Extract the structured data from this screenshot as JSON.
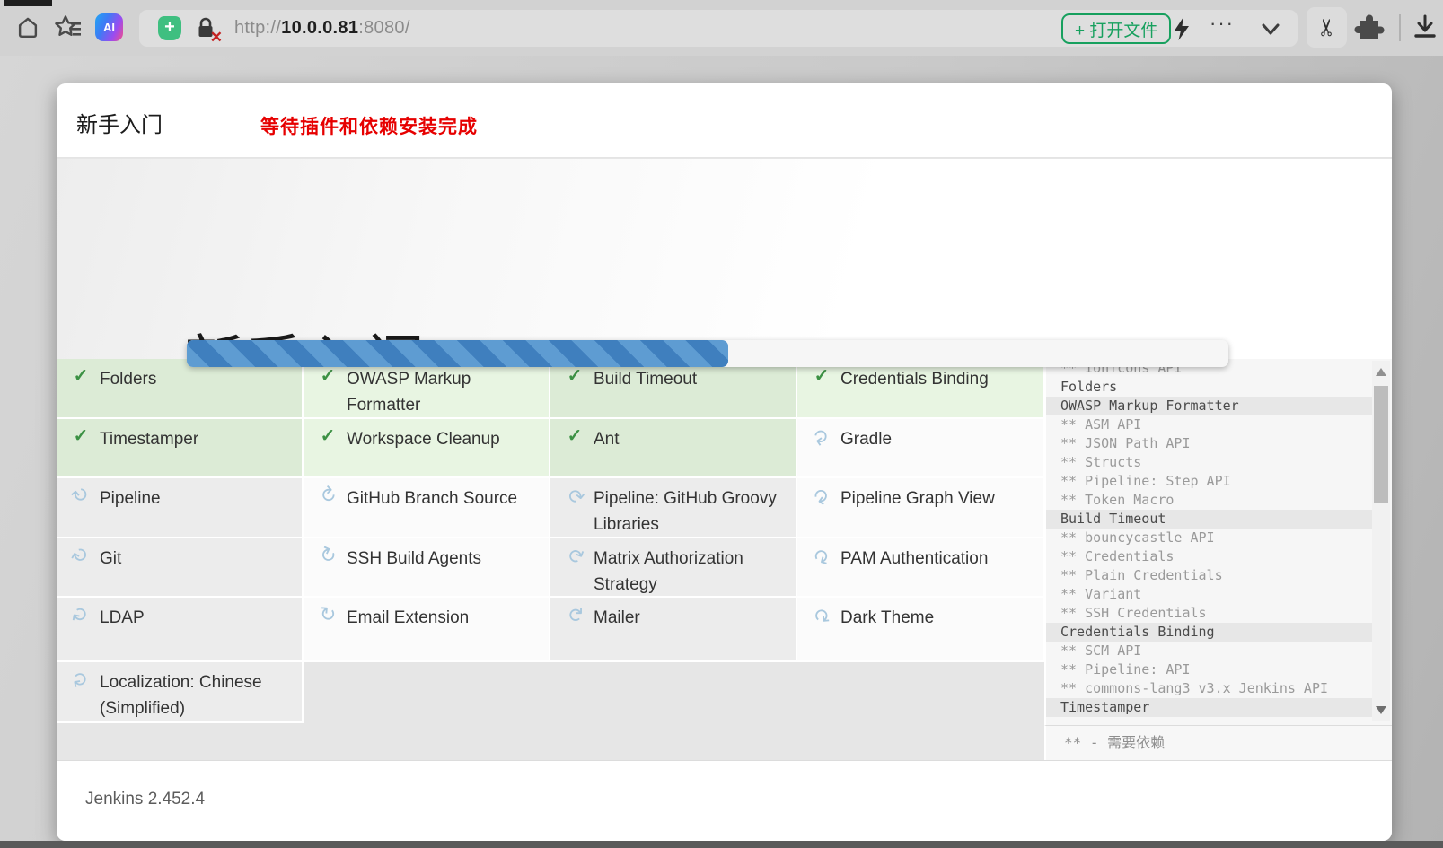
{
  "browser": {
    "url": {
      "scheme": "http://",
      "host": "10.0.0.81",
      "port": ":8080",
      "path": "/"
    },
    "open_file_button": "+ 打开文件",
    "ai_badge": "AI",
    "shield_plus": "+",
    "dots": "···",
    "scissors_glyph": "✂"
  },
  "wizard": {
    "header_title": "新手入门",
    "header_notice": "等待插件和依赖安装完成",
    "hero_title": "新手入门",
    "progress_percent": 52,
    "legend": "** - 需要依赖",
    "footer_version": "Jenkins 2.452.4"
  },
  "colors": {
    "progress_blue_light": "#5e9cd2",
    "progress_blue_dark": "#3f7fbe",
    "success_green": "#3c9144",
    "notice_red": "#e60000",
    "button_green": "#17a05e",
    "done_cell_green": "#e8f5e2",
    "spinner_blue": "#a9c8de"
  },
  "plugins": {
    "cells": [
      {
        "label": "Folders",
        "status": "done"
      },
      {
        "label": "OWASP Markup Formatter",
        "status": "done"
      },
      {
        "label": "Build Timeout",
        "status": "done"
      },
      {
        "label": "Credentials Binding",
        "status": "done"
      },
      {
        "label": "Timestamper",
        "status": "done"
      },
      {
        "label": "Workspace Cleanup",
        "status": "done"
      },
      {
        "label": "Ant",
        "status": "done"
      },
      {
        "label": "Gradle",
        "status": "installing"
      },
      {
        "label": "Pipeline",
        "status": "installing"
      },
      {
        "label": "GitHub Branch Source",
        "status": "installing"
      },
      {
        "label": "Pipeline: GitHub Groovy Libraries",
        "status": "installing"
      },
      {
        "label": "Pipeline Graph View",
        "status": "installing"
      },
      {
        "label": "Git",
        "status": "installing"
      },
      {
        "label": "SSH Build Agents",
        "status": "installing"
      },
      {
        "label": "Matrix Authorization Strategy",
        "status": "installing"
      },
      {
        "label": "PAM Authentication",
        "status": "installing"
      },
      {
        "label": "LDAP",
        "status": "installing"
      },
      {
        "label": "Email Extension",
        "status": "installing"
      },
      {
        "label": "Mailer",
        "status": "installing"
      },
      {
        "label": "Dark Theme",
        "status": "installing"
      },
      {
        "label": "Localization: Chinese (Simplified)",
        "status": "installing"
      },
      {
        "label": "",
        "status": "empty"
      },
      {
        "label": "",
        "status": "empty"
      },
      {
        "label": "",
        "status": "empty"
      }
    ]
  },
  "log": {
    "items": [
      {
        "text": "** Ionicons API",
        "dep": true,
        "highlight": false
      },
      {
        "text": "Folders",
        "dep": false,
        "highlight": false
      },
      {
        "text": "OWASP Markup Formatter",
        "dep": false,
        "highlight": true
      },
      {
        "text": "** ASM API",
        "dep": true,
        "highlight": false
      },
      {
        "text": "** JSON Path API",
        "dep": true,
        "highlight": false
      },
      {
        "text": "** Structs",
        "dep": true,
        "highlight": false
      },
      {
        "text": "** Pipeline: Step API",
        "dep": true,
        "highlight": false
      },
      {
        "text": "** Token Macro",
        "dep": true,
        "highlight": false
      },
      {
        "text": "Build Timeout",
        "dep": false,
        "highlight": true
      },
      {
        "text": "** bouncycastle API",
        "dep": true,
        "highlight": false
      },
      {
        "text": "** Credentials",
        "dep": true,
        "highlight": false
      },
      {
        "text": "** Plain Credentials",
        "dep": true,
        "highlight": false
      },
      {
        "text": "** Variant",
        "dep": true,
        "highlight": false
      },
      {
        "text": "** SSH Credentials",
        "dep": true,
        "highlight": false
      },
      {
        "text": "Credentials Binding",
        "dep": false,
        "highlight": true
      },
      {
        "text": "** SCM API",
        "dep": true,
        "highlight": false
      },
      {
        "text": "** Pipeline: API",
        "dep": true,
        "highlight": false
      },
      {
        "text": "** commons-lang3 v3.x Jenkins API",
        "dep": true,
        "highlight": false
      },
      {
        "text": "Timestamper",
        "dep": false,
        "highlight": true
      }
    ]
  }
}
